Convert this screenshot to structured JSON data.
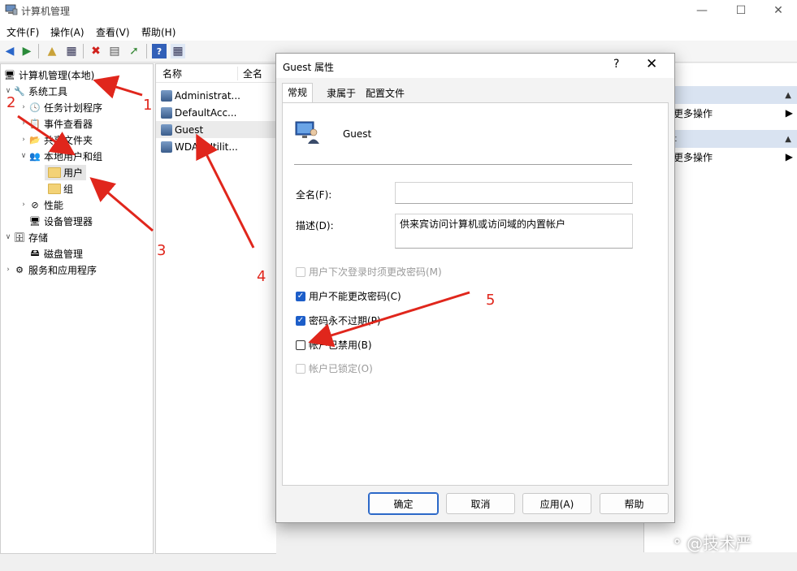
{
  "window": {
    "title": "计算机管理"
  },
  "menu": [
    "文件(F)",
    "操作(A)",
    "查看(V)",
    "帮助(H)"
  ],
  "tree": {
    "root": "计算机管理(本地)",
    "system_tools": "系统工具",
    "task_scheduler": "任务计划程序",
    "event_viewer": "事件查看器",
    "shared_folders": "共享文件夹",
    "local_users_groups": "本地用户和组",
    "users": "用户",
    "groups": "组",
    "performance": "性能",
    "device_manager": "设备管理器",
    "storage": "存储",
    "disk_management": "磁盘管理",
    "services_apps": "服务和应用程序"
  },
  "list": {
    "col_name": "名称",
    "col_fullname": "全名",
    "rows": [
      "Administrat...",
      "DefaultAcc...",
      "Guest",
      "WDAGUtilit..."
    ]
  },
  "actions": {
    "more1": "更多操作",
    "head2": "t",
    "more2": "更多操作"
  },
  "dialog": {
    "title": "Guest 属性",
    "help": "?",
    "tabs": [
      "常规",
      "隶属于",
      "配置文件"
    ],
    "username": "Guest",
    "fullname_label": "全名(F):",
    "fullname_value": "",
    "desc_label": "描述(D):",
    "desc_value": "供来宾访问计算机或访问域的内置帐户",
    "checkboxes": {
      "must_change": "用户下次登录时须更改密码(M)",
      "cannot_change": "用户不能更改密码(C)",
      "never_expires": "密码永不过期(P)",
      "disabled": "帐户已禁用(B)",
      "locked": "帐户已锁定(O)"
    },
    "checked": {
      "must_change": false,
      "cannot_change": true,
      "never_expires": true,
      "disabled": false,
      "locked": false
    },
    "buttons": {
      "ok": "确定",
      "cancel": "取消",
      "apply": "应用(A)",
      "help": "帮助"
    }
  },
  "annotations": {
    "n1": "1",
    "n2": "2",
    "n3": "3",
    "n4": "4",
    "n5": "5",
    "color": "#e0261c"
  },
  "watermark": "@技术严"
}
